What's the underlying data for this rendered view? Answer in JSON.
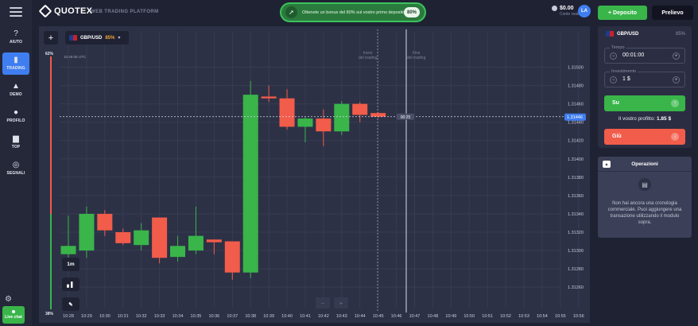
{
  "topbar": {
    "logo_text": "QUOTEX",
    "tagline": "WEB TRADING PLATFORM",
    "promo_text": "Ottenete un bonus del 80% sul vostro primo deposito",
    "promo_badge": "80%",
    "balance": "$0.00",
    "account_type": "Conto reale",
    "avatar_initials": "LA",
    "deposit_label": "Deposito",
    "withdraw_label": "Prelievo"
  },
  "sidebar": {
    "items": [
      {
        "icon": "help-icon",
        "glyph": "?",
        "label": "AIUTO",
        "active": false
      },
      {
        "icon": "trading-chart-icon",
        "glyph": "▮",
        "label": "TRADING",
        "active": true
      },
      {
        "icon": "graduation-cap-icon",
        "glyph": "▲",
        "label": "DEMO",
        "active": false
      },
      {
        "icon": "user-icon",
        "glyph": "●",
        "label": "PROFILO",
        "active": false
      },
      {
        "icon": "podium-icon",
        "glyph": "▆",
        "label": "TOP",
        "active": false
      },
      {
        "icon": "signal-icon",
        "glyph": "◎",
        "label": "SEGNALI",
        "active": false
      }
    ],
    "live_chat_label": "Live chat"
  },
  "chart_header": {
    "asset": "GBP/USD",
    "payout": "85%",
    "clock": "10:45:05 UTC",
    "pct_top": "62%",
    "pct_bottom": "38%",
    "start_label_1": "Inizio",
    "start_label_2": "del trading",
    "end_label_1": "Fine",
    "end_label_2": "del trading",
    "timeframe": "1m",
    "countdown": "00:25",
    "current_price": "1.31446"
  },
  "chart_data": {
    "type": "candlestick",
    "title": "",
    "x_ticks": [
      "10:28",
      "10:29",
      "10:30",
      "10:31",
      "10:32",
      "10:33",
      "10:34",
      "10:35",
      "10:36",
      "10:37",
      "10:38",
      "10:39",
      "10:40",
      "10:41",
      "10:42",
      "10:43",
      "10:44",
      "10:45",
      "10:46",
      "10:47",
      "10:48",
      "10:49",
      "10:50",
      "10:51",
      "10:52",
      "10:53",
      "10:54",
      "10:55",
      "10:56"
    ],
    "y_ticks": [
      "1.31500",
      "1.31480",
      "1.31460",
      "1.31440",
      "1.31420",
      "1.31400",
      "1.31380",
      "1.31360",
      "1.31340",
      "1.31320",
      "1.31300",
      "1.31280",
      "1.31260"
    ],
    "ylim": [
      1.31248,
      1.3151
    ],
    "candles": [
      {
        "t": "10:28",
        "o": 1.31296,
        "h": 1.31338,
        "l": 1.31285,
        "c": 1.31305
      },
      {
        "t": "10:29",
        "o": 1.313,
        "h": 1.31348,
        "l": 1.31292,
        "c": 1.3134
      },
      {
        "t": "10:30",
        "o": 1.3134,
        "h": 1.31344,
        "l": 1.31316,
        "c": 1.31322
      },
      {
        "t": "10:31",
        "o": 1.3132,
        "h": 1.31324,
        "l": 1.31306,
        "c": 1.31308
      },
      {
        "t": "10:32",
        "o": 1.31306,
        "h": 1.3133,
        "l": 1.313,
        "c": 1.31322
      },
      {
        "t": "10:33",
        "o": 1.31336,
        "h": 1.31336,
        "l": 1.31286,
        "c": 1.31292
      },
      {
        "t": "10:34",
        "o": 1.31293,
        "h": 1.31316,
        "l": 1.31288,
        "c": 1.31305
      },
      {
        "t": "10:35",
        "o": 1.313,
        "h": 1.31348,
        "l": 1.31296,
        "c": 1.31316
      },
      {
        "t": "10:36",
        "o": 1.31312,
        "h": 1.31312,
        "l": 1.31296,
        "c": 1.31309
      },
      {
        "t": "10:37",
        "o": 1.3131,
        "h": 1.3131,
        "l": 1.31268,
        "c": 1.31276
      },
      {
        "t": "10:38",
        "o": 1.31276,
        "h": 1.31485,
        "l": 1.3127,
        "c": 1.3147
      },
      {
        "t": "10:39",
        "o": 1.31468,
        "h": 1.3148,
        "l": 1.31462,
        "c": 1.31466
      },
      {
        "t": "10:40",
        "o": 1.31466,
        "h": 1.31476,
        "l": 1.31432,
        "c": 1.31435
      },
      {
        "t": "10:41",
        "o": 1.31435,
        "h": 1.31446,
        "l": 1.31418,
        "c": 1.31444
      },
      {
        "t": "10:42",
        "o": 1.31444,
        "h": 1.31454,
        "l": 1.31414,
        "c": 1.3143
      },
      {
        "t": "10:43",
        "o": 1.3143,
        "h": 1.31463,
        "l": 1.31426,
        "c": 1.3146
      },
      {
        "t": "10:44",
        "o": 1.3146,
        "h": 1.31462,
        "l": 1.3144,
        "c": 1.31448
      },
      {
        "t": "10:45",
        "o": 1.3145,
        "h": 1.31451,
        "l": 1.31445,
        "c": 1.31446
      }
    ],
    "colors": {
      "up": "#39b54a",
      "down": "#f25c4a",
      "price_badge": "#3f7ef0"
    },
    "grid": true
  },
  "panel": {
    "asset": "GBP/USD",
    "payout": "85%",
    "time_label": "Tempo",
    "time_value": "00:01:00",
    "investment_label": "Investimento",
    "investment_value": "1 $",
    "up_label": "Su",
    "down_label": "Giù",
    "profit_label": "Il vostro profitto:",
    "profit_value": "1.85 $"
  },
  "operations": {
    "title": "Operazioni",
    "empty_text": "Non hai ancora una cronologia commerciale. Puoi aggiungere una transazione utilizzando il modulo sopra."
  }
}
